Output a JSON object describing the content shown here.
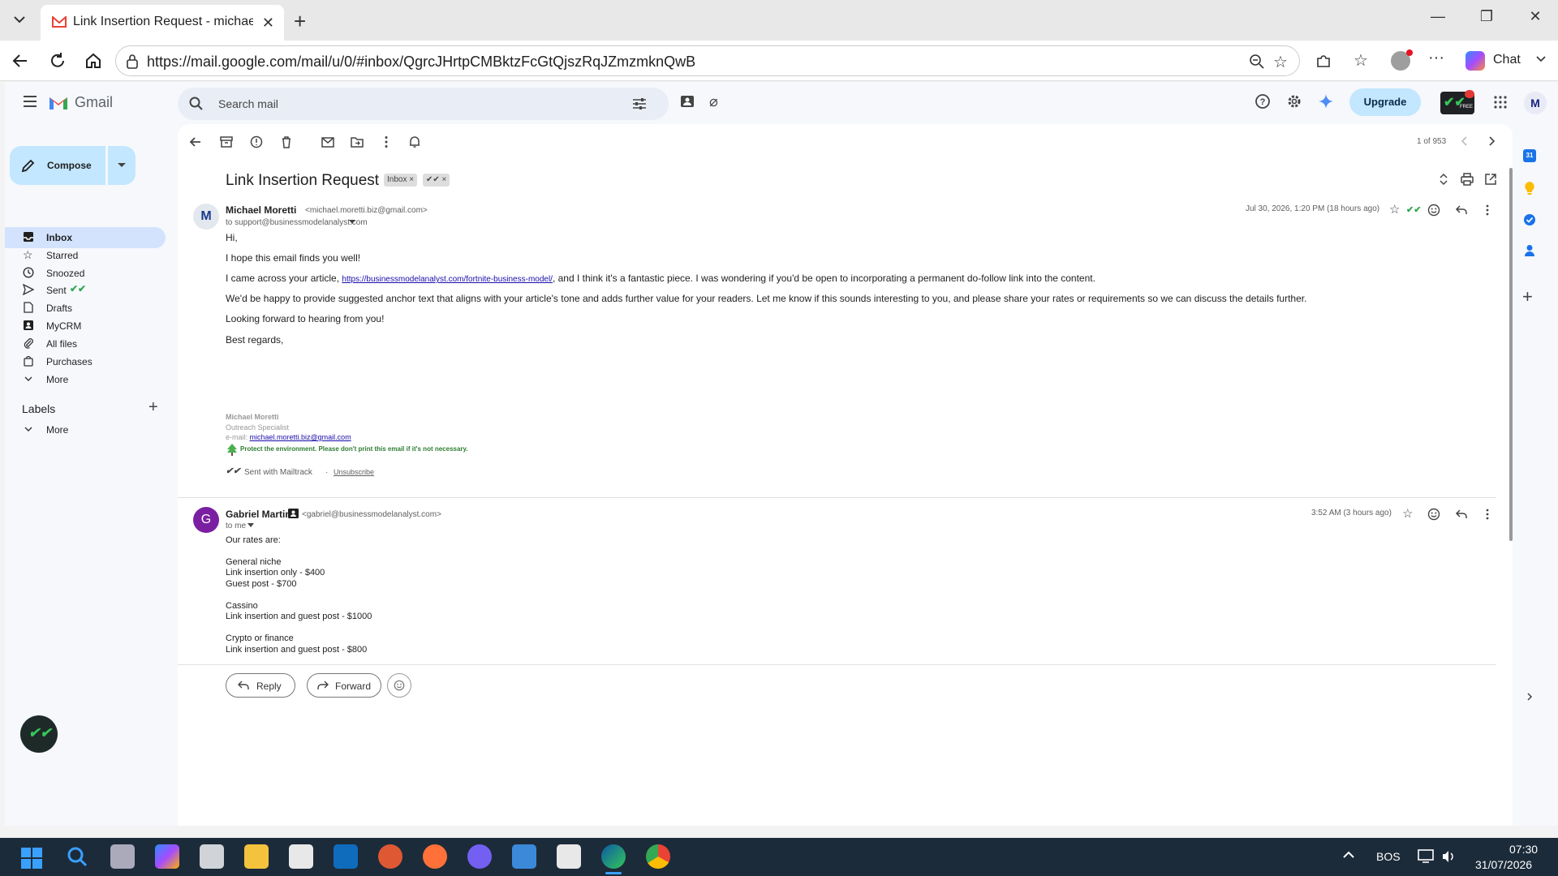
{
  "browser": {
    "tab_title": "Link Insertion Request - michael.m",
    "url": "https://mail.google.com/mail/u/0/#inbox/QgrcJHrtpCMBktzFcGtQjszRqJZmzmknQwB",
    "chat_label": "Chat"
  },
  "gmail": {
    "logo_text": "Gmail",
    "search_placeholder": "Search mail",
    "upgrade_label": "Upgrade",
    "mailtrack_badge": "FREE",
    "account_initial": "M",
    "compose_label": "Compose",
    "nav": [
      {
        "label": "Inbox",
        "icon": "inbox-icon",
        "active": true
      },
      {
        "label": "Starred",
        "icon": "star-icon"
      },
      {
        "label": "Snoozed",
        "icon": "clock-icon"
      },
      {
        "label": "Sent",
        "icon": "send-icon"
      },
      {
        "label": "Drafts",
        "icon": "draft-icon"
      },
      {
        "label": "MyCRM",
        "icon": "contact-card-icon"
      },
      {
        "label": "All files",
        "icon": "paperclip-icon"
      },
      {
        "label": "Purchases",
        "icon": "shopping-bag-icon"
      },
      {
        "label": "More",
        "icon": "chevron-down-icon"
      }
    ],
    "labels_heading": "Labels",
    "labels_more": "More",
    "pagination": "1 of 953"
  },
  "thread": {
    "subject": "Link Insertion Request",
    "chip_inbox": "Inbox ×",
    "chip_tracked": "✔✔ ×",
    "messages": [
      {
        "sender": "Michael Moretti",
        "email": "<michael.moretti.biz@gmail.com>",
        "to": "to support@businessmodelanalyst.com",
        "avatar": "M",
        "date": "Jul 30, 2026, 1:20 PM (18 hours ago)",
        "greeting": "Hi,",
        "p1": "I hope this email finds you well!",
        "p2_pre": "I came across your article, ",
        "p2_link": "https://businessmodelanalyst.com/fortnite-business-model/",
        "p2_post": ", and I think it's a fantastic piece. I was wondering if you'd be open to incorporating a permanent do-follow link into the content.",
        "p3": "We'd be happy to provide suggested anchor text that aligns with your article's tone and adds further value for your readers. Let me know if this sounds interesting to you, and please share your rates or requirements so we can discuss the details further.",
        "p4": "Looking forward to hearing from you!",
        "p5": "Best regards,",
        "sig_name": "Michael Moretti",
        "sig_title": "Outreach Specialist",
        "sig_email_label": "e-mail: ",
        "sig_email": "michael.moretti.biz@gmail.com",
        "sig_env": "Protect the environment. Please don't print this email if it's not necessary.",
        "mailtrack": "Sent with Mailtrack",
        "unsubscribe": "Unsubscribe"
      },
      {
        "sender": "Gabriel Martins",
        "email": "<gabriel@businessmodelanalyst.com>",
        "to": "to me",
        "avatar": "G",
        "date": "3:52 AM (3 hours ago)",
        "lines": [
          "Our rates are:",
          "",
          "General niche",
          "Link insertion only - $400",
          "Guest post - $700",
          "",
          "Cassino",
          "Link insertion and guest post - $1000",
          "",
          "Crypto or finance",
          "Link insertion and guest post - $800"
        ]
      }
    ],
    "reply_label": "Reply",
    "forward_label": "Forward"
  },
  "taskbar": {
    "language": "BOS",
    "time": "07:30",
    "date": "31/07/2026"
  },
  "colors": {
    "compose_bg": "#c2e7ff",
    "active_nav": "#d3e3fd",
    "avatar_g": "#7b1fa2",
    "mailtrack_green": "#2e7d32"
  }
}
